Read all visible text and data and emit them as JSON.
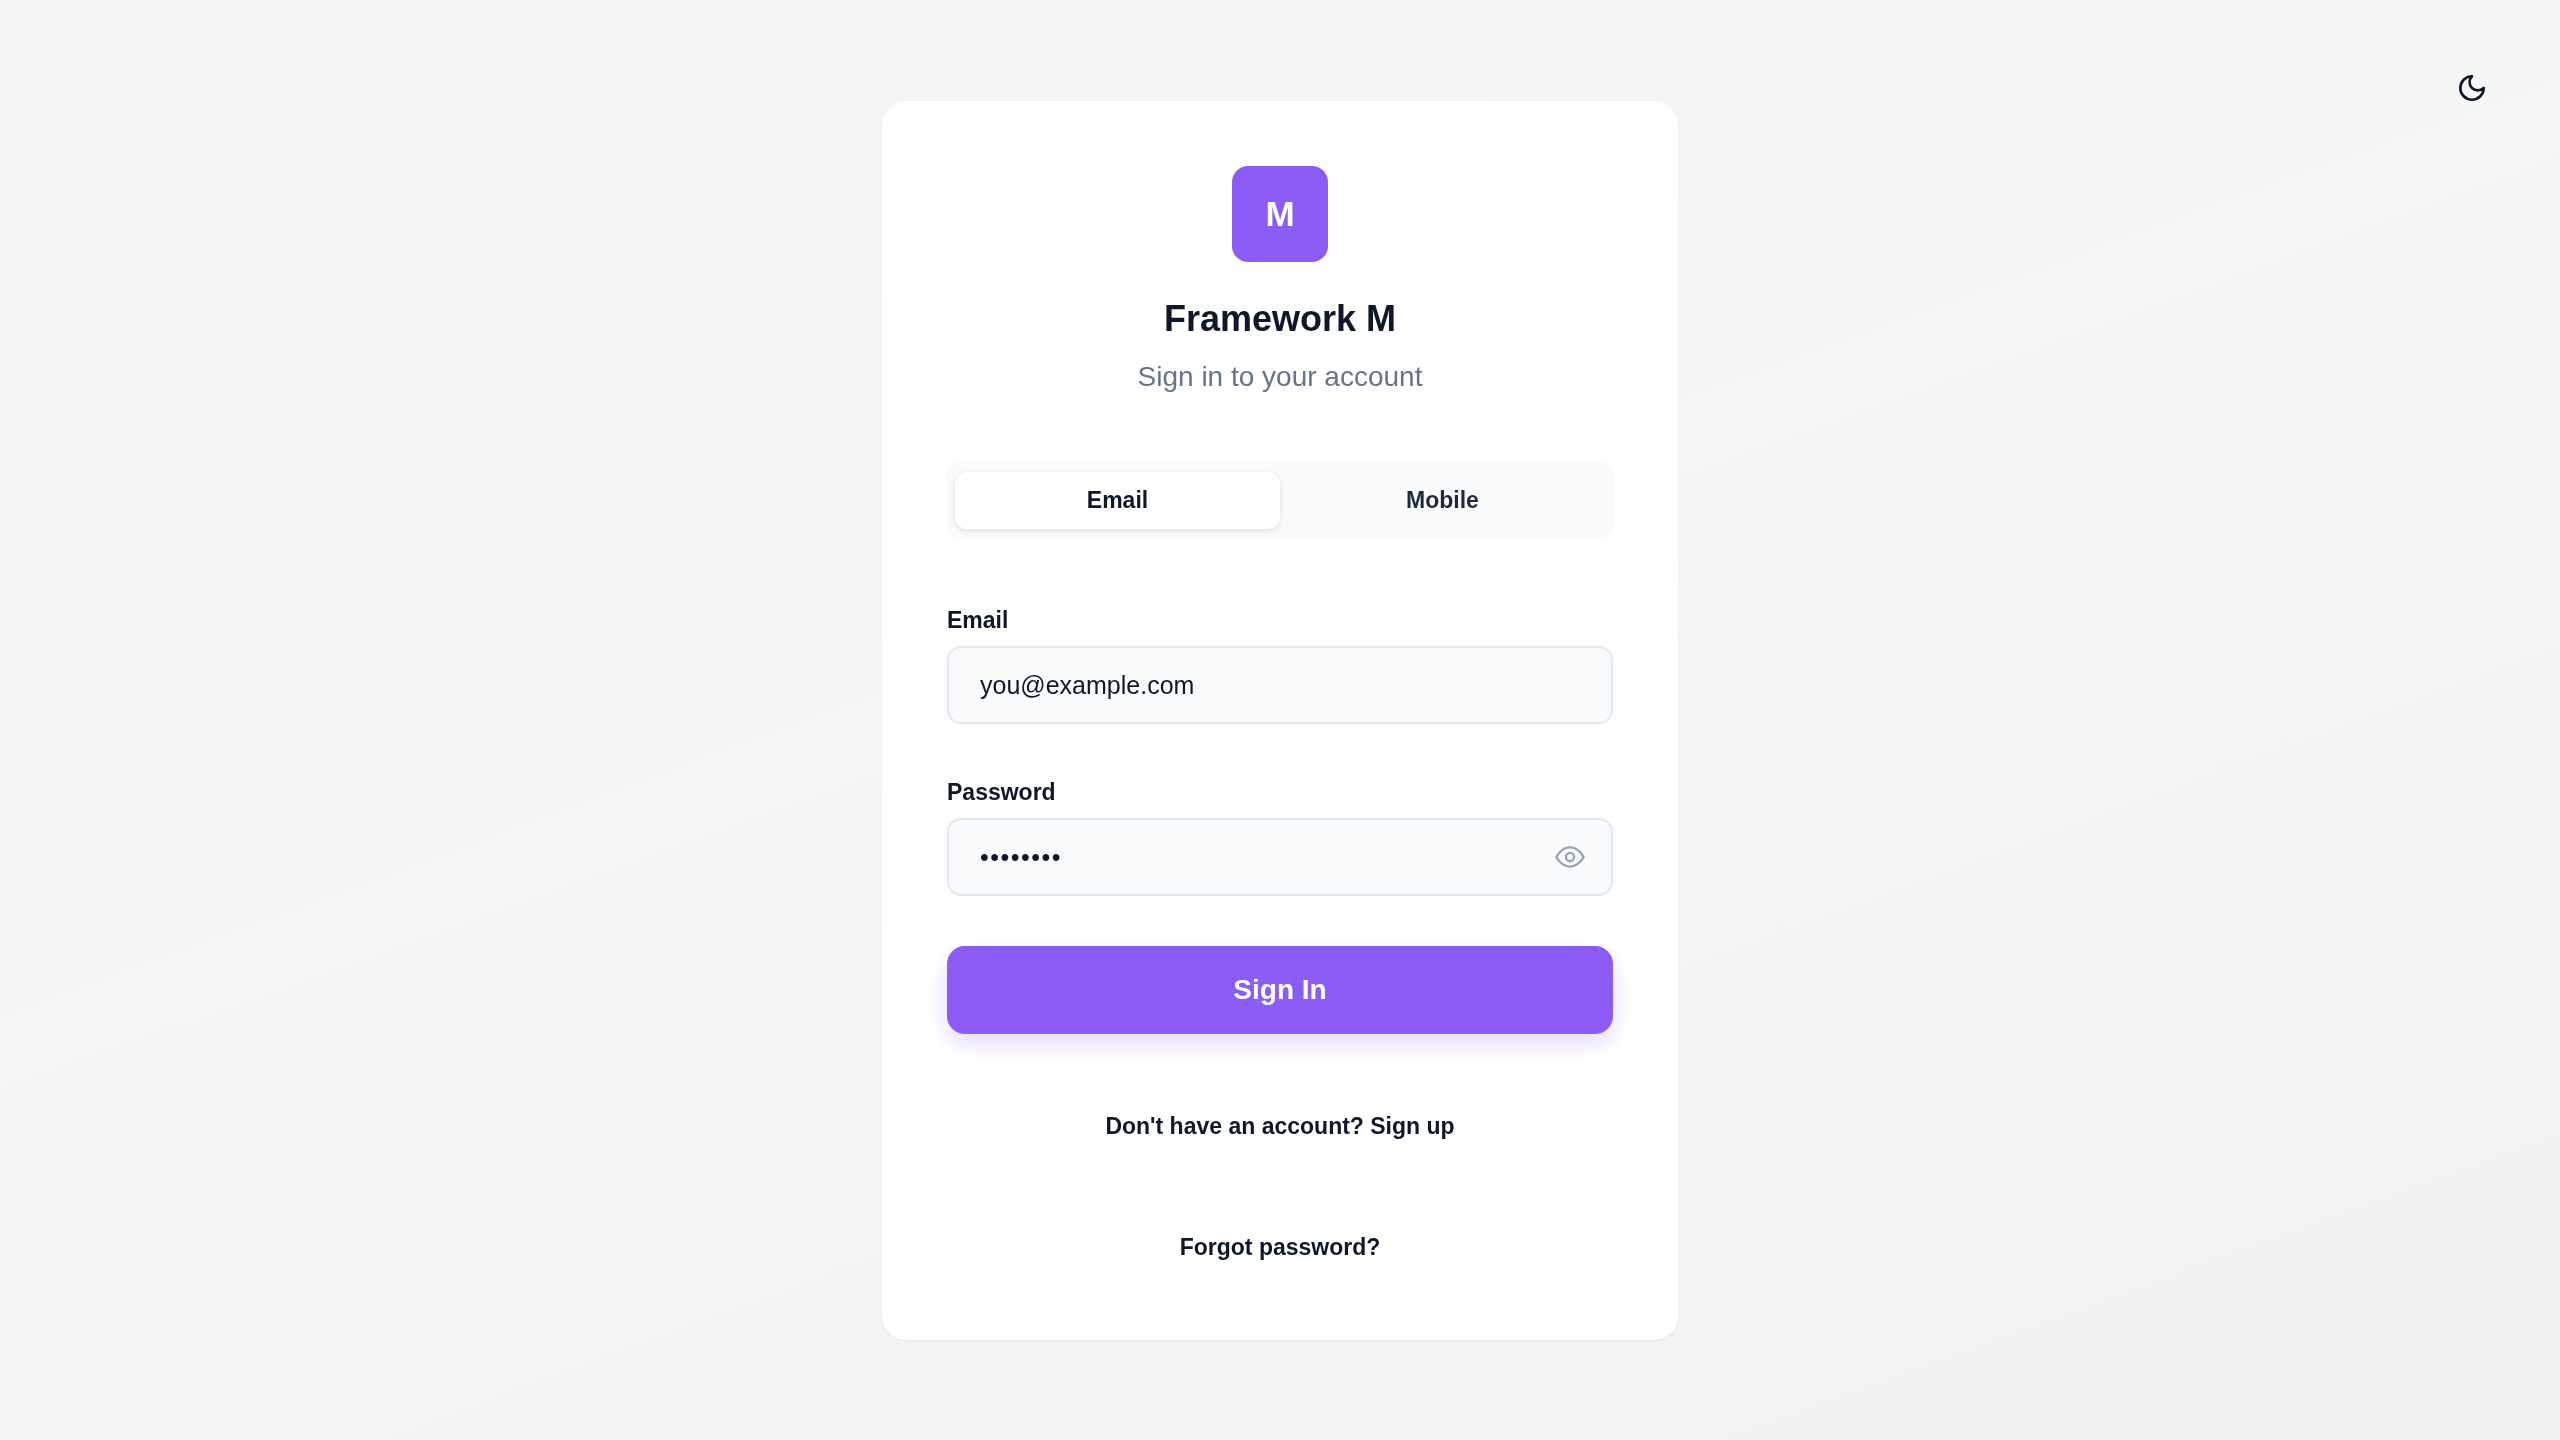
{
  "logo": {
    "letter": "M"
  },
  "title": "Framework M",
  "subtitle": "Sign in to your account",
  "tabs": [
    {
      "label": "Email",
      "selected": true
    },
    {
      "label": "Mobile",
      "selected": false
    }
  ],
  "fields": [
    {
      "kind": "email",
      "label": "Email",
      "value": "you@example.com"
    },
    {
      "kind": "password",
      "label": "Password",
      "value": "••••••••"
    }
  ],
  "submit_button": "Sign In",
  "signup_link": "Don't have an account? Sign up",
  "forgot_password_link": "Forgot password?"
}
